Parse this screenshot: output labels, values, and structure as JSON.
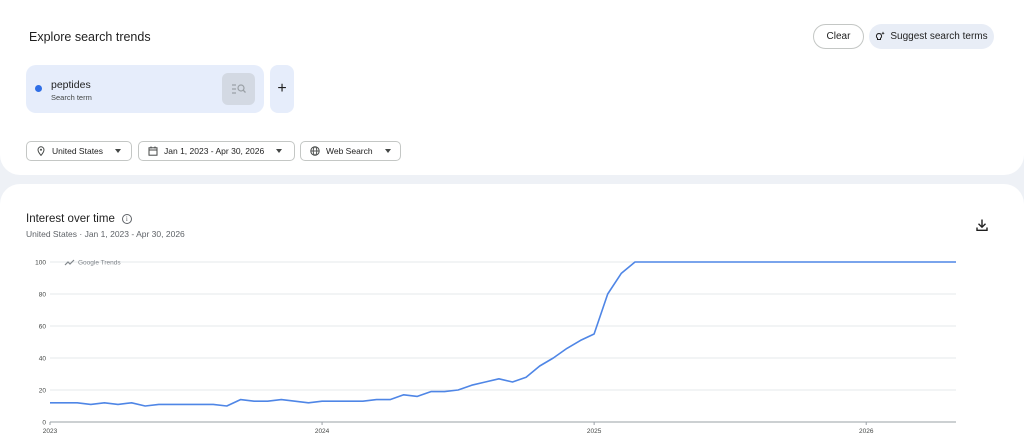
{
  "header": {
    "title": "Explore search trends"
  },
  "actions": {
    "clear_label": "Clear",
    "suggest_label": "Suggest search terms"
  },
  "term": {
    "name": "peptides",
    "subtitle": "Search term",
    "color": "#2f6ee6"
  },
  "filters": {
    "region": "United States",
    "date_range": "Jan 1, 2023 - Apr 30, 2026",
    "property": "Web Search"
  },
  "section": {
    "title": "Interest over time",
    "subtitle": "United States · Jan 1, 2023 - Apr 30, 2026"
  },
  "icons": {
    "suggest": "sparkle-bulb-icon",
    "term_action": "search-list-icon",
    "add": "plus-icon",
    "region": "location-pin-icon",
    "date": "calendar-icon",
    "property": "globe-icon",
    "info": "info-icon",
    "download": "download-icon"
  },
  "chart_data": {
    "type": "line",
    "watermark": "Google Trends",
    "y_ticks": [
      0,
      20,
      40,
      60,
      80,
      100
    ],
    "ylim": [
      0,
      100
    ],
    "x_ticks": [
      "2023",
      "2024",
      "2025",
      "2026"
    ],
    "xlim": [
      2023.0,
      2026.33
    ],
    "grid": true,
    "series": [
      {
        "color": "#4f86e6",
        "x": [
          2023.0,
          2023.05,
          2023.1,
          2023.15,
          2023.2,
          2023.25,
          2023.3,
          2023.35,
          2023.4,
          2023.45,
          2023.5,
          2023.55,
          2023.6,
          2023.65,
          2023.7,
          2023.75,
          2023.8,
          2023.85,
          2023.9,
          2023.95,
          2024.0,
          2024.05,
          2024.1,
          2024.15,
          2024.2,
          2024.25,
          2024.3,
          2024.35,
          2024.4,
          2024.45,
          2024.5,
          2024.55,
          2024.6,
          2024.65,
          2024.7,
          2024.75,
          2024.8,
          2024.85,
          2024.9,
          2024.95,
          2025.0,
          2025.05,
          2025.1,
          2025.15,
          2025.2,
          2025.25,
          2025.3,
          2025.35,
          2025.4,
          2025.45,
          2025.5,
          2025.55,
          2025.6,
          2025.65,
          2025.7,
          2025.75,
          2025.8,
          2025.85,
          2025.9,
          2025.95,
          2026.0,
          2026.05,
          2026.1,
          2026.15,
          2026.2,
          2026.25,
          2026.33
        ],
        "y": [
          12,
          12,
          12,
          11,
          12,
          11,
          12,
          10,
          11,
          11,
          11,
          11,
          11,
          10,
          14,
          13,
          13,
          14,
          13,
          12,
          13,
          13,
          13,
          13,
          14,
          14,
          17,
          16,
          19,
          19,
          20,
          23,
          25,
          27,
          25,
          28,
          35,
          40,
          46,
          51,
          55,
          80,
          93,
          100,
          100,
          100,
          100,
          100,
          100,
          100,
          100,
          100,
          100,
          100,
          100,
          100,
          100,
          100,
          100,
          100,
          100,
          100,
          100,
          100,
          100,
          100,
          100
        ]
      }
    ]
  }
}
